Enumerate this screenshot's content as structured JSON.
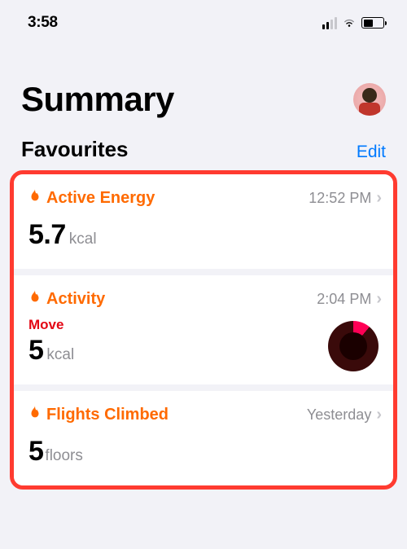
{
  "status": {
    "time": "3:58"
  },
  "header": {
    "title": "Summary"
  },
  "favourites": {
    "label": "Favourites",
    "edit": "Edit"
  },
  "cards": {
    "energy": {
      "title": "Active Energy",
      "time": "12:52 PM",
      "value": "5.7",
      "unit": "kcal"
    },
    "activity": {
      "title": "Activity",
      "time": "2:04 PM",
      "move_label": "Move",
      "value": "5",
      "unit": "kcal"
    },
    "flights": {
      "title": "Flights Climbed",
      "time": "Yesterday",
      "value": "5",
      "unit": "floors"
    }
  },
  "colors": {
    "accent": "#ff6a00",
    "link": "#007aff",
    "move": "#e30613",
    "highlight": "#ff3b30"
  }
}
